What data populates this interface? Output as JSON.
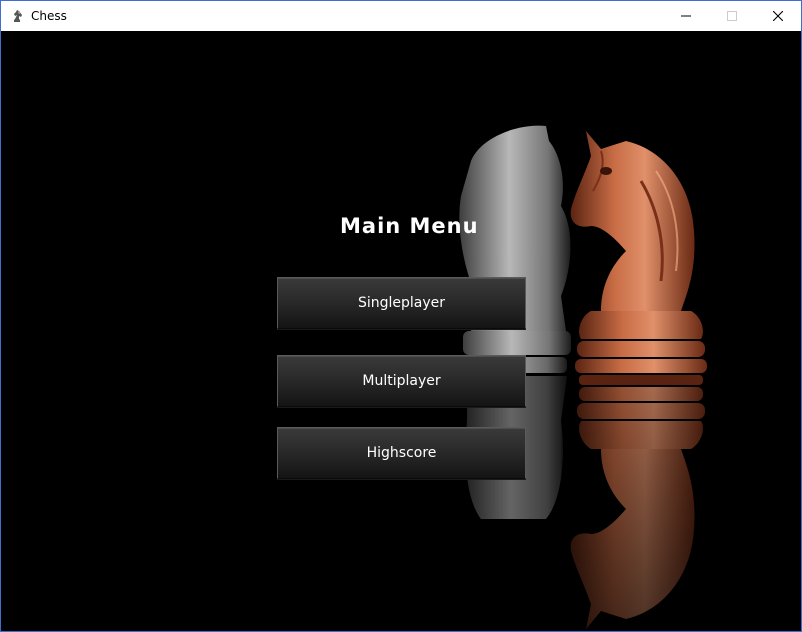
{
  "window": {
    "title": "Chess",
    "app_icon": "chess-knight-icon",
    "controls": [
      "minimize-icon",
      "maximize-icon",
      "close-icon"
    ]
  },
  "menu": {
    "title": "Main Menu",
    "buttons": [
      {
        "label": "Singleplayer"
      },
      {
        "label": "Multiplayer"
      },
      {
        "label": "Highscore"
      }
    ]
  },
  "colors": {
    "background": "#000000",
    "button_top": "#3a3a3a",
    "button_bottom": "#141414",
    "text": "#ffffff",
    "copper_knight": "#b8623f",
    "silver_knight": "#cfcfcf"
  }
}
